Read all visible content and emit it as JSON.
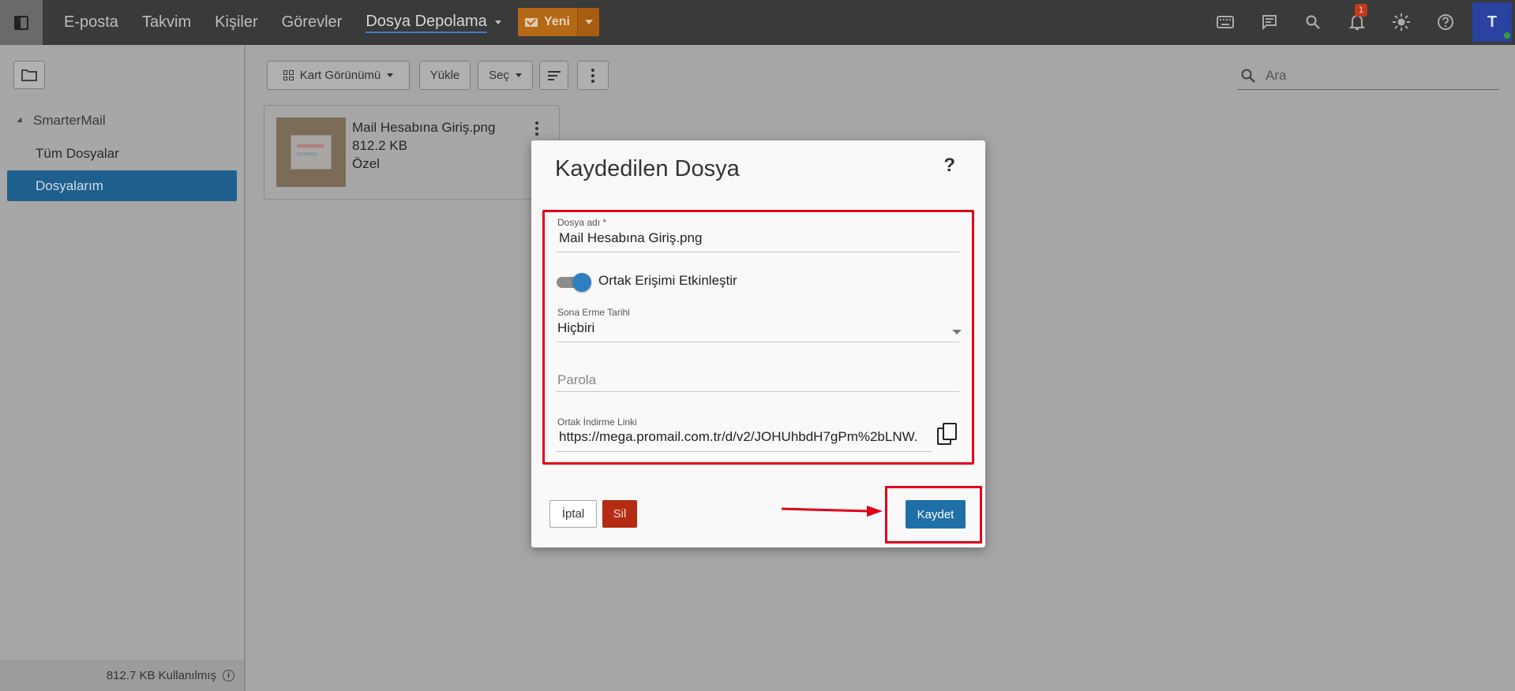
{
  "topbar": {
    "nav": [
      "E-posta",
      "Takvim",
      "Kişiler",
      "Görevler",
      "Dosya Depolama"
    ],
    "new_label": "Yeni",
    "notification_count": "1",
    "avatar_initial": "T",
    "icons": [
      "keyboard-icon",
      "chat-icon",
      "search-icon",
      "bell-icon",
      "sun-icon",
      "help-icon"
    ]
  },
  "sidebar": {
    "root": "SmarterMail",
    "items": [
      "Tüm Dosyalar",
      "Dosyalarım"
    ],
    "selected": "Dosyalarım",
    "usage": "812.7 KB Kullanılmış"
  },
  "toolbar": {
    "view_label": "Kart Görünümü",
    "upload_label": "Yükle",
    "select_label": "Seç",
    "search_placeholder": "Ara"
  },
  "file": {
    "name": "Mail Hesabına Giriş.png",
    "size": "812.2 KB",
    "visibility": "Özel"
  },
  "modal": {
    "title": "Kaydedilen Dosya",
    "help": "?",
    "filename_label": "Dosya adı *",
    "filename_value": "Mail Hesabına Giriş.png",
    "public_toggle_label": "Ortak Erişimi Etkinleştir",
    "public_enabled": true,
    "expiry_label": "Sona Erme Tarihi",
    "expiry_value": "Hiçbiri",
    "password_placeholder": "Parola",
    "link_label": "Ortak İndirme Linki",
    "link_value": "https://mega.promail.com.tr/d/v2/JOHUhbdH7gPm%2bLNW.",
    "cancel_label": "İptal",
    "delete_label": "Sil",
    "save_label": "Kaydet"
  },
  "colors": {
    "accent": "#1f6fa8",
    "new_button": "#b56816",
    "delete": "#b32b12",
    "annotation": "#e1001a"
  }
}
